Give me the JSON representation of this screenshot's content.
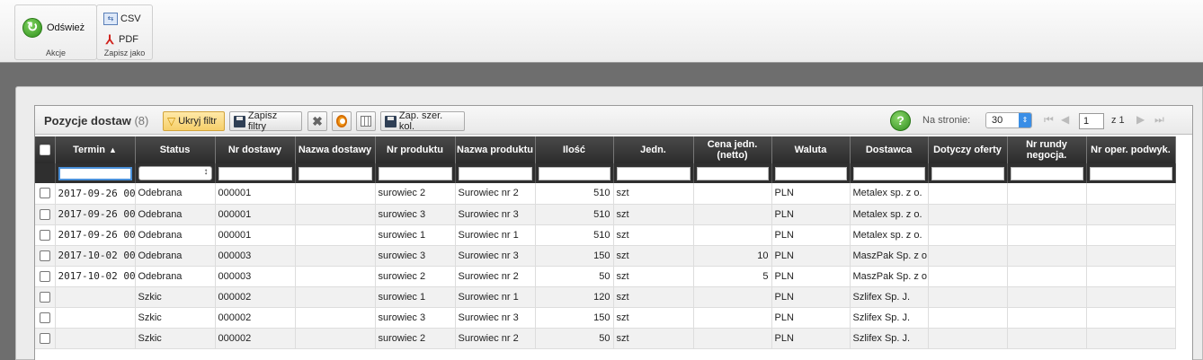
{
  "ribbon": {
    "refresh_label": "Odśwież",
    "akcje_label": "Akcje",
    "csv_label": "CSV",
    "pdf_label": "PDF",
    "zapisz_label": "Zapisz jako"
  },
  "panel": {
    "title": "Pozycje dostaw",
    "count": "(8)",
    "btn_hide_filter": "Ukryj filtr",
    "btn_save_filters": "Zapisz filtry",
    "btn_save_widths": "Zap. szer. kol.",
    "help_glyph": "?",
    "per_page_label": "Na stronie:",
    "per_page_value": "30",
    "page_current": "1",
    "page_of": "z 1"
  },
  "columns": [
    "Termin",
    "Status",
    "Nr dostawy",
    "Nazwa dostawy",
    "Nr produktu",
    "Nazwa produktu",
    "Ilość",
    "Jedn.",
    "Cena jedn. (netto)",
    "Waluta",
    "Dostawca",
    "Dotyczy oferty",
    "Nr rundy negocja.",
    "Nr oper. podwyk."
  ],
  "rows": [
    {
      "termin": "2017-09-26 00",
      "status": "Odebrana",
      "nr_dostawy": "000001",
      "nazwa_dostawy": "",
      "nr_produktu": "surowiec 2",
      "nazwa_produktu": "Surowiec nr 2",
      "ilosc": "510",
      "jedn": "szt",
      "cena": "",
      "waluta": "PLN",
      "dostawca": "Metalex sp. z o.",
      "oferta": "",
      "runda": "",
      "oper": ""
    },
    {
      "termin": "2017-09-26 00",
      "status": "Odebrana",
      "nr_dostawy": "000001",
      "nazwa_dostawy": "",
      "nr_produktu": "surowiec 3",
      "nazwa_produktu": "Surowiec nr 3",
      "ilosc": "510",
      "jedn": "szt",
      "cena": "",
      "waluta": "PLN",
      "dostawca": "Metalex sp. z o.",
      "oferta": "",
      "runda": "",
      "oper": ""
    },
    {
      "termin": "2017-09-26 00",
      "status": "Odebrana",
      "nr_dostawy": "000001",
      "nazwa_dostawy": "",
      "nr_produktu": "surowiec 1",
      "nazwa_produktu": "Surowiec nr 1",
      "ilosc": "510",
      "jedn": "szt",
      "cena": "",
      "waluta": "PLN",
      "dostawca": "Metalex sp. z o.",
      "oferta": "",
      "runda": "",
      "oper": ""
    },
    {
      "termin": "2017-10-02 00",
      "status": "Odebrana",
      "nr_dostawy": "000003",
      "nazwa_dostawy": "",
      "nr_produktu": "surowiec 3",
      "nazwa_produktu": "Surowiec nr 3",
      "ilosc": "150",
      "jedn": "szt",
      "cena": "10",
      "waluta": "PLN",
      "dostawca": "MaszPak Sp. z o",
      "oferta": "",
      "runda": "",
      "oper": ""
    },
    {
      "termin": "2017-10-02 00",
      "status": "Odebrana",
      "nr_dostawy": "000003",
      "nazwa_dostawy": "",
      "nr_produktu": "surowiec 2",
      "nazwa_produktu": "Surowiec nr 2",
      "ilosc": "50",
      "jedn": "szt",
      "cena": "5",
      "waluta": "PLN",
      "dostawca": "MaszPak Sp. z o",
      "oferta": "",
      "runda": "",
      "oper": ""
    },
    {
      "termin": "",
      "status": "Szkic",
      "nr_dostawy": "000002",
      "nazwa_dostawy": "",
      "nr_produktu": "surowiec 1",
      "nazwa_produktu": "Surowiec nr 1",
      "ilosc": "120",
      "jedn": "szt",
      "cena": "",
      "waluta": "PLN",
      "dostawca": "Szlifex Sp. J.",
      "oferta": "",
      "runda": "",
      "oper": ""
    },
    {
      "termin": "",
      "status": "Szkic",
      "nr_dostawy": "000002",
      "nazwa_dostawy": "",
      "nr_produktu": "surowiec 3",
      "nazwa_produktu": "Surowiec nr 3",
      "ilosc": "150",
      "jedn": "szt",
      "cena": "",
      "waluta": "PLN",
      "dostawca": "Szlifex Sp. J.",
      "oferta": "",
      "runda": "",
      "oper": ""
    },
    {
      "termin": "",
      "status": "Szkic",
      "nr_dostawy": "000002",
      "nazwa_dostawy": "",
      "nr_produktu": "surowiec 2",
      "nazwa_produktu": "Surowiec nr 2",
      "ilosc": "50",
      "jedn": "szt",
      "cena": "",
      "waluta": "PLN",
      "dostawca": "Szlifex Sp. J.",
      "oferta": "",
      "runda": "",
      "oper": ""
    }
  ]
}
